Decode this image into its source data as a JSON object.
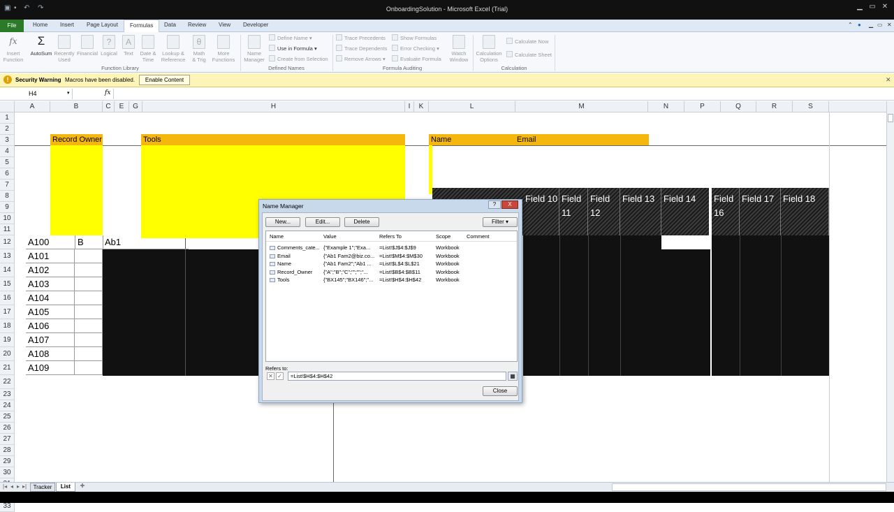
{
  "window": {
    "title": "OnboardingSolution - Microsoft Excel (Trial)"
  },
  "tabs": [
    "File",
    "Home",
    "Insert",
    "Page Layout",
    "Formulas",
    "Data",
    "Review",
    "View",
    "Developer"
  ],
  "ribbon": {
    "function_library": {
      "group": "Function Library",
      "insert_function": "Insert\nFunction",
      "autosum": "AutoSum",
      "recently_used": "Recently\nUsed",
      "financial": "Financial",
      "logical": "Logical",
      "text": "Text",
      "date_time": "Date &\nTime",
      "lookup": "Lookup &\nReference",
      "math": "Math\n& Trig",
      "more": "More\nFunctions"
    },
    "defined_names": {
      "group": "Defined Names",
      "name_manager": "Name\nManager",
      "define_name": "Define Name",
      "use_in_formula": "Use in Formula",
      "create_from_selection": "Create from Selection"
    },
    "formula_auditing": {
      "group": "Formula Auditing",
      "trace_precedents": "Trace Precedents",
      "trace_dependents": "Trace Dependents",
      "remove_arrows": "Remove Arrows",
      "show_formulas": "Show Formulas",
      "error_checking": "Error Checking",
      "evaluate_formula": "Evaluate Formula",
      "watch_window": "Watch\nWindow"
    },
    "calculation": {
      "group": "Calculation",
      "calc_options": "Calculation\nOptions",
      "calculate_now": "Calculate Now",
      "calculate_sheet": "Calculate Sheet"
    }
  },
  "security": {
    "label": "Security Warning",
    "message": "Macros have been disabled.",
    "button": "Enable Content"
  },
  "formula_bar": {
    "name_box": "H4",
    "fx": "fx",
    "formula": ""
  },
  "columns": [
    "A",
    "B",
    "C",
    "E",
    "G",
    "H",
    "I",
    "K",
    "L",
    "M",
    "N",
    "P",
    "Q",
    "R",
    "S"
  ],
  "rows": [
    "1",
    "2",
    "3",
    "4",
    "5",
    "6",
    "7",
    "8",
    "9",
    "10",
    "11",
    "12",
    "13",
    "14",
    "15",
    "16",
    "17",
    "18",
    "19",
    "20",
    "21",
    "22",
    "23",
    "24",
    "25",
    "26",
    "27",
    "28",
    "29",
    "30",
    "31",
    "32",
    "33"
  ],
  "sheet": {
    "record_owner": "Record Owner",
    "tools": "Tools",
    "name": "Name",
    "email": "Email",
    "row12": [
      "A100",
      "B",
      "Ab1"
    ],
    "a_values": [
      "A101",
      "A102",
      "A103",
      "A104",
      "A105",
      "A106",
      "A107",
      "A108",
      "A109"
    ],
    "fields": [
      {
        "label": "Field 10"
      },
      {
        "label": "Field\n11"
      },
      {
        "label": "Field\n12"
      },
      {
        "label": "Field 13"
      },
      {
        "label": "Field 14"
      },
      {
        "label": "Field\n16"
      },
      {
        "label": "Field 17"
      },
      {
        "label": "Field 18"
      }
    ]
  },
  "dialog": {
    "title": "Name Manager",
    "help": "?",
    "close_x": "X",
    "new": "New...",
    "edit": "Edit...",
    "delete": "Delete",
    "filter": "Filter",
    "headers": [
      "Name",
      "Value",
      "Refers To",
      "Scope",
      "Comment"
    ],
    "rows": [
      {
        "name": "Comments_cate...",
        "value": "{\"Example 1\";\"Exa...",
        "refers": "=List!$J$4:$J$9",
        "scope": "Workbook"
      },
      {
        "name": "Email",
        "value": "{\"Ab1 Fam2@biz.co...",
        "refers": "=List!$M$4:$M$30",
        "scope": "Workbook"
      },
      {
        "name": "Name",
        "value": "{\"Ab1 Fam2\";\"Ab1 ...",
        "refers": "=List!$L$4:$L$21",
        "scope": "Workbook"
      },
      {
        "name": "Record_Owner",
        "value": "{\"A\";\"B\";\"C\";\"\";\"\";\"...",
        "refers": "=List!$B$4:$B$11",
        "scope": "Workbook"
      },
      {
        "name": "Tools",
        "value": "{\"BX145\";\"BX146\";\"...",
        "refers": "=List!$H$4:$H$42",
        "scope": "Workbook"
      }
    ],
    "refers_label": "Refers to:",
    "refers_value": "=List!$H$4:$H$42",
    "close": "Close"
  },
  "sheet_tabs": [
    "Tracker",
    "List"
  ]
}
